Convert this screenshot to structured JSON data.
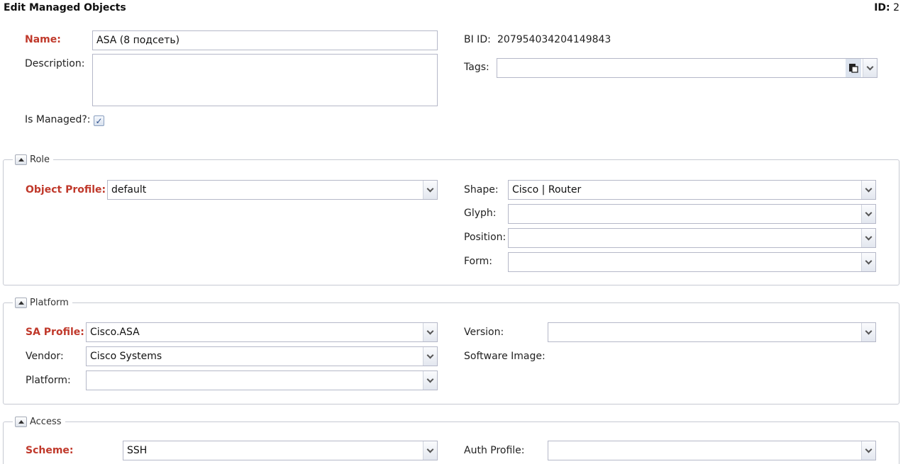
{
  "header": {
    "title": "Edit Managed Objects",
    "id_label": "ID:",
    "id_value": "2"
  },
  "main": {
    "name_label": "Name:",
    "name_value": "ASA (8 подсеть)",
    "description_label": "Description:",
    "description_value": "",
    "is_managed_label": "Is Managed?:",
    "is_managed_checked": true,
    "bi_id_label": "BI ID:",
    "bi_id_value": "207954034204149843",
    "tags_label": "Tags:",
    "tags_value": ""
  },
  "role": {
    "legend": "Role",
    "object_profile_label": "Object Profile:",
    "object_profile_value": "default",
    "shape_label": "Shape:",
    "shape_value": "Cisco | Router",
    "glyph_label": "Glyph:",
    "glyph_value": "",
    "position_label": "Position:",
    "position_value": "",
    "form_label": "Form:",
    "form_value": ""
  },
  "platform": {
    "legend": "Platform",
    "sa_profile_label": "SA Profile:",
    "sa_profile_value": "Cisco.ASA",
    "vendor_label": "Vendor:",
    "vendor_value": "Cisco Systems",
    "platform_label": "Platform:",
    "platform_value": "",
    "version_label": "Version:",
    "version_value": "",
    "software_image_label": "Software Image:"
  },
  "access": {
    "legend": "Access",
    "scheme_label": "Scheme:",
    "scheme_value": "SSH",
    "auth_profile_label": "Auth Profile:",
    "auth_profile_value": ""
  },
  "colors": {
    "required": "#c0392b",
    "border": "#b5b8c8"
  },
  "icons": {
    "collapse": "triangle-up-icon",
    "dropdown": "chevron-down-icon",
    "tag_picker": "clipboard-icon",
    "checkbox": "check-icon"
  }
}
